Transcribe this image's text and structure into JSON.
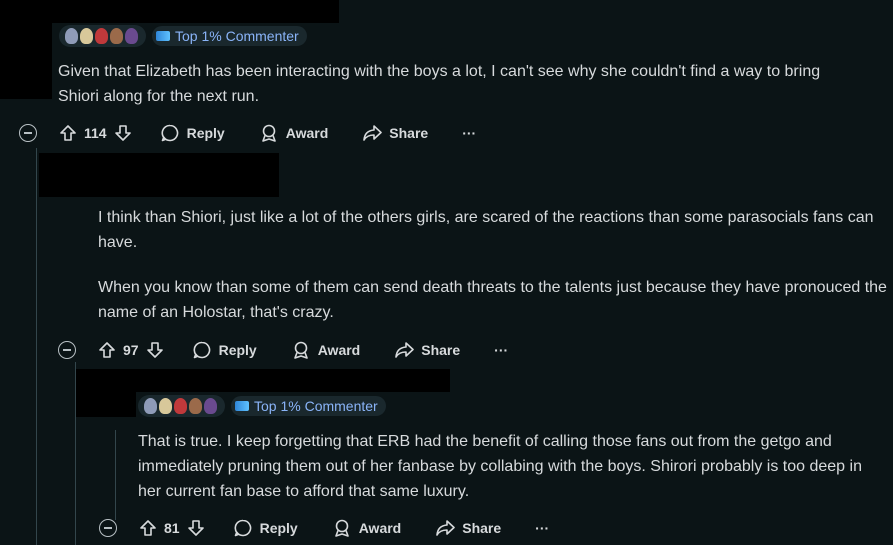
{
  "comments": [
    {
      "badge": "Top 1% Commenter",
      "body": [
        "Given that Elizabeth has been interacting with the boys a lot, I can't see why she couldn't find a way to bring Shiori along for the next run."
      ],
      "votes": "114"
    },
    {
      "body": [
        "I think than Shiori, just like a lot of the others girls, are scared of the reactions than some parasocials fans can have.",
        "When you know than some of them can send death threats to the talents just because they have pronouced the name of an Holostar, that's crazy."
      ],
      "votes": "97"
    },
    {
      "badge": "Top 1% Commenter",
      "body": [
        "That is true. I keep forgetting that ERB had the benefit of calling those fans out from the getgo and immediately pruning them out of her fanbase by collabing with the boys. Shirori probably is too deep in her current fan base to afford that same luxury."
      ],
      "votes": "81"
    }
  ],
  "actions": {
    "reply": "Reply",
    "award": "Award",
    "share": "Share",
    "more": "···"
  },
  "icons": [
    "collapse-icon",
    "upvote-icon",
    "downvote-icon",
    "reply-icon",
    "award-icon",
    "share-icon",
    "more-icon",
    "top-commenter-icon",
    "flair-avatars"
  ],
  "colors": {
    "background": "#0b1416",
    "text": "#d7dadc",
    "badge_text": "#8ab4f8",
    "redaction": "#000000",
    "thread_line": "#33464c"
  }
}
